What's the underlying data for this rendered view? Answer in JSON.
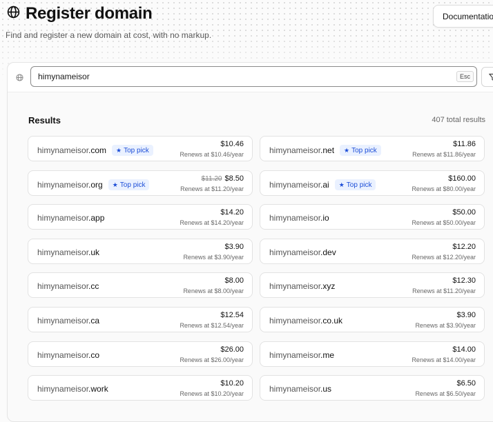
{
  "header": {
    "title": "Register domain",
    "subtitle": "Find and register a new domain at cost, with no markup.",
    "documentation_label": "Documentation"
  },
  "search": {
    "value": "himynameisor",
    "esc_label": "Esc"
  },
  "results": {
    "label": "Results",
    "total": "407 total results",
    "top_pick_label": "Top pick",
    "items": [
      {
        "base": "himynameisor",
        "tld": ".com",
        "top": true,
        "old": "",
        "price": "$10.46",
        "renew": "Renews at $10.46/year"
      },
      {
        "base": "himynameisor",
        "tld": ".net",
        "top": true,
        "old": "",
        "price": "$11.86",
        "renew": "Renews at $11.86/year"
      },
      {
        "base": "himynameisor",
        "tld": ".org",
        "top": true,
        "old": "$11.20",
        "price": "$8.50",
        "renew": "Renews at $11.20/year"
      },
      {
        "base": "himynameisor",
        "tld": ".ai",
        "top": true,
        "old": "",
        "price": "$160.00",
        "renew": "Renews at $80.00/year"
      },
      {
        "base": "himynameisor",
        "tld": ".app",
        "top": false,
        "old": "",
        "price": "$14.20",
        "renew": "Renews at $14.20/year"
      },
      {
        "base": "himynameisor",
        "tld": ".io",
        "top": false,
        "old": "",
        "price": "$50.00",
        "renew": "Renews at $50.00/year"
      },
      {
        "base": "himynameisor",
        "tld": ".uk",
        "top": false,
        "old": "",
        "price": "$3.90",
        "renew": "Renews at $3.90/year"
      },
      {
        "base": "himynameisor",
        "tld": ".dev",
        "top": false,
        "old": "",
        "price": "$12.20",
        "renew": "Renews at $12.20/year"
      },
      {
        "base": "himynameisor",
        "tld": ".cc",
        "top": false,
        "old": "",
        "price": "$8.00",
        "renew": "Renews at $8.00/year"
      },
      {
        "base": "himynameisor",
        "tld": ".xyz",
        "top": false,
        "old": "",
        "price": "$12.30",
        "renew": "Renews at $11.20/year"
      },
      {
        "base": "himynameisor",
        "tld": ".ca",
        "top": false,
        "old": "",
        "price": "$12.54",
        "renew": "Renews at $12.54/year"
      },
      {
        "base": "himynameisor",
        "tld": ".co.uk",
        "top": false,
        "old": "",
        "price": "$3.90",
        "renew": "Renews at $3.90/year"
      },
      {
        "base": "himynameisor",
        "tld": ".co",
        "top": false,
        "old": "",
        "price": "$26.00",
        "renew": "Renews at $26.00/year"
      },
      {
        "base": "himynameisor",
        "tld": ".me",
        "top": false,
        "old": "",
        "price": "$14.00",
        "renew": "Renews at $14.00/year"
      },
      {
        "base": "himynameisor",
        "tld": ".work",
        "top": false,
        "old": "",
        "price": "$10.20",
        "renew": "Renews at $10.20/year"
      },
      {
        "base": "himynameisor",
        "tld": ".us",
        "top": false,
        "old": "",
        "price": "$6.50",
        "renew": "Renews at $6.50/year"
      }
    ]
  }
}
